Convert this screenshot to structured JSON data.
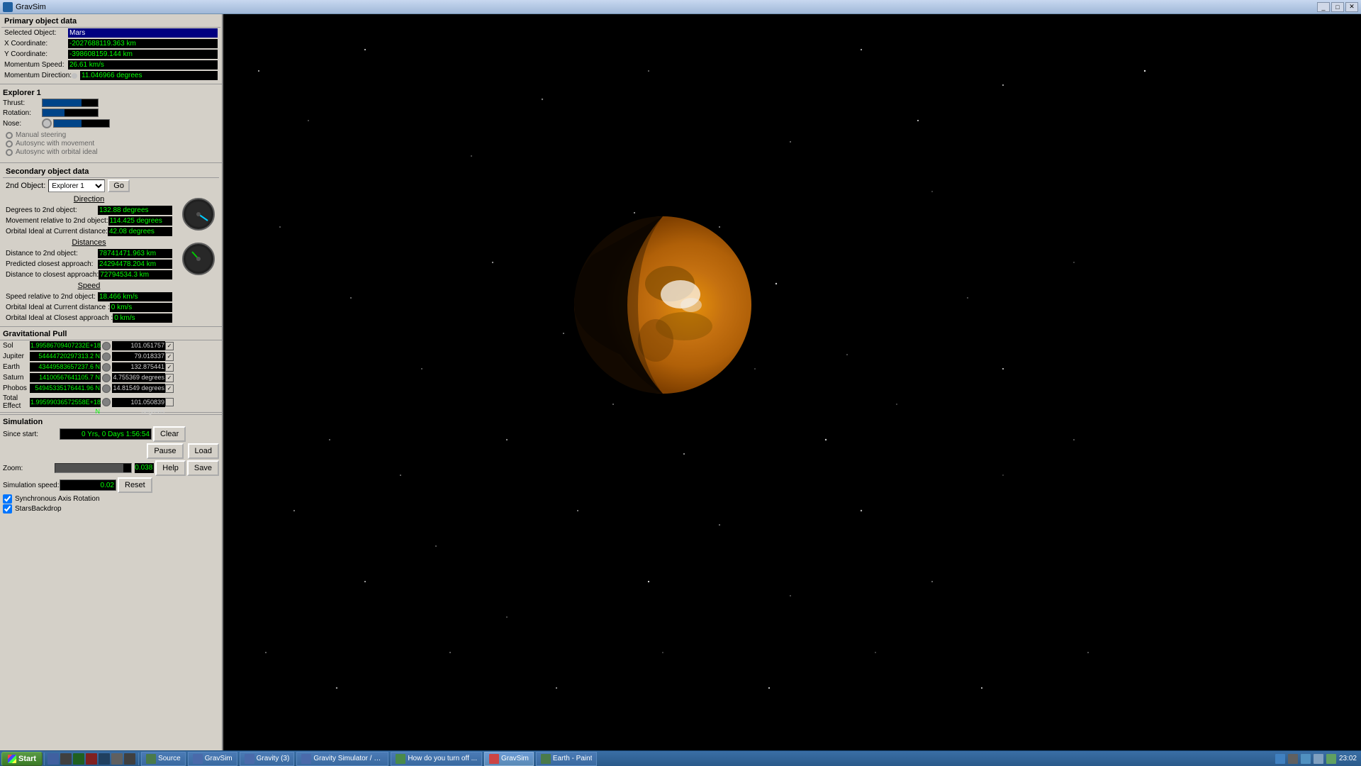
{
  "titlebar": {
    "title": "GravSim",
    "close": "✕",
    "minimize": "_",
    "maximize": "□"
  },
  "primary_data": {
    "header": "Primary object data",
    "selected_object_label": "Selected Object:",
    "selected_object_value": "Mars",
    "x_coordinate_label": "X Coordinate:",
    "x_coordinate_value": "-2027688119.363 km",
    "y_coordinate_label": "Y Coordinate:",
    "y_coordinate_value": "-398608159.144 km",
    "momentum_speed_label": "Momentum Speed:",
    "momentum_speed_value": "26.61 km/s",
    "momentum_dir_label": "Momentum Direction:",
    "momentum_dir_value": "11.046966 degrees"
  },
  "explorer1": {
    "title": "Explorer 1",
    "thrust_label": "Thrust:",
    "rotation_label": "Rotation:",
    "nose_label": "Nose:",
    "manual_steering": "Manual steering",
    "autosync_movement": "Autosync with movement",
    "autosync_orbital": "Autosync with orbital ideal"
  },
  "secondary_data": {
    "header": "Secondary object data",
    "second_object_label": "2nd Object:",
    "second_object_value": "Explorer 1",
    "go_button": "Go",
    "direction_header": "Direction",
    "degrees_label": "Degrees to 2nd object:",
    "degrees_value": "132.88 degrees",
    "movement_label": "Movement relative to 2nd object:",
    "movement_value": "114.425 degrees",
    "orbital_label": "Orbital Ideal at Current distance:",
    "orbital_value": "42.08 degrees",
    "distances_header": "Distances",
    "distance_label": "Distance to 2nd object:",
    "distance_value": "78741471.963 km",
    "predicted_label": "Predicted closest approach:",
    "predicted_value": "24294478.204 km",
    "closest_label": "Distance to closest approach:",
    "closest_value": "72794534.3 km",
    "speed_header": "Speed",
    "speed_relative_label": "Speed relative to 2nd object:",
    "speed_relative_value": "18.466 km/s",
    "orbital_current_label": "Orbital Ideal at Current distance :",
    "orbital_current_value": "0 km/s",
    "orbital_closest_label": "Orbital Ideal at Closest approach :",
    "orbital_closest_value": "0 km/s"
  },
  "gravitational_pull": {
    "header": "Gravitational Pull",
    "objects": [
      {
        "name": "Sol",
        "force": "1.99586709407232E+18 N",
        "degrees": "101.051757 degrees",
        "checked": true
      },
      {
        "name": "Jupiter",
        "force": "54444720297313.2 N",
        "degrees": "79.018337 degrees",
        "checked": true
      },
      {
        "name": "Earth",
        "force": "43449583657237.6 N",
        "degrees": "132.875441 degrees",
        "checked": true
      },
      {
        "name": "Saturn",
        "force": "14100567641105.7 N",
        "degrees": "4.755369 degrees",
        "checked": true
      },
      {
        "name": "Phobos",
        "force": "54945335176441.96 N",
        "degrees": "14.81549 degrees",
        "checked": true
      },
      {
        "name": "Total Effect",
        "force": "1.99599036572558E+18 N",
        "degrees": "101.050839 degrees",
        "checked": false
      }
    ]
  },
  "simulation": {
    "header": "Simulation",
    "since_start_label": "Since start:",
    "since_start_value": "0 Yrs, 0 Days 1:56:54",
    "clear_button": "Clear",
    "pause_button": "Pause",
    "load_button": "Load",
    "zoom_label": "Zoom:",
    "zoom_value": "0.038",
    "help_button": "Help",
    "save_button": "Save",
    "sim_speed_label": "Simulation speed:",
    "sim_speed_value": "0.02",
    "reset_button": "Reset",
    "synchro_axis": "Synchronous Axis Rotation",
    "stars_backdrop": "StarsBackdrop"
  },
  "taskbar": {
    "start_label": "Start",
    "time": "23:02",
    "buttons": [
      {
        "label": "Source",
        "icon_color": "#4a7a4a",
        "active": false
      },
      {
        "label": "GravSim",
        "icon_color": "#4a6aaa",
        "active": false
      },
      {
        "label": "Gravity (3)",
        "icon_color": "#4a6aaa",
        "active": false
      },
      {
        "label": "Gravity Simulator / S...",
        "icon_color": "#4a6aaa",
        "active": false
      },
      {
        "label": "How do you turn off ...",
        "icon_color": "#4a8a4a",
        "active": false
      },
      {
        "label": "GravSim",
        "icon_color": "#cc4444",
        "active": true
      },
      {
        "label": "Earth - Paint",
        "icon_color": "#4a7a4a",
        "active": false
      }
    ]
  }
}
